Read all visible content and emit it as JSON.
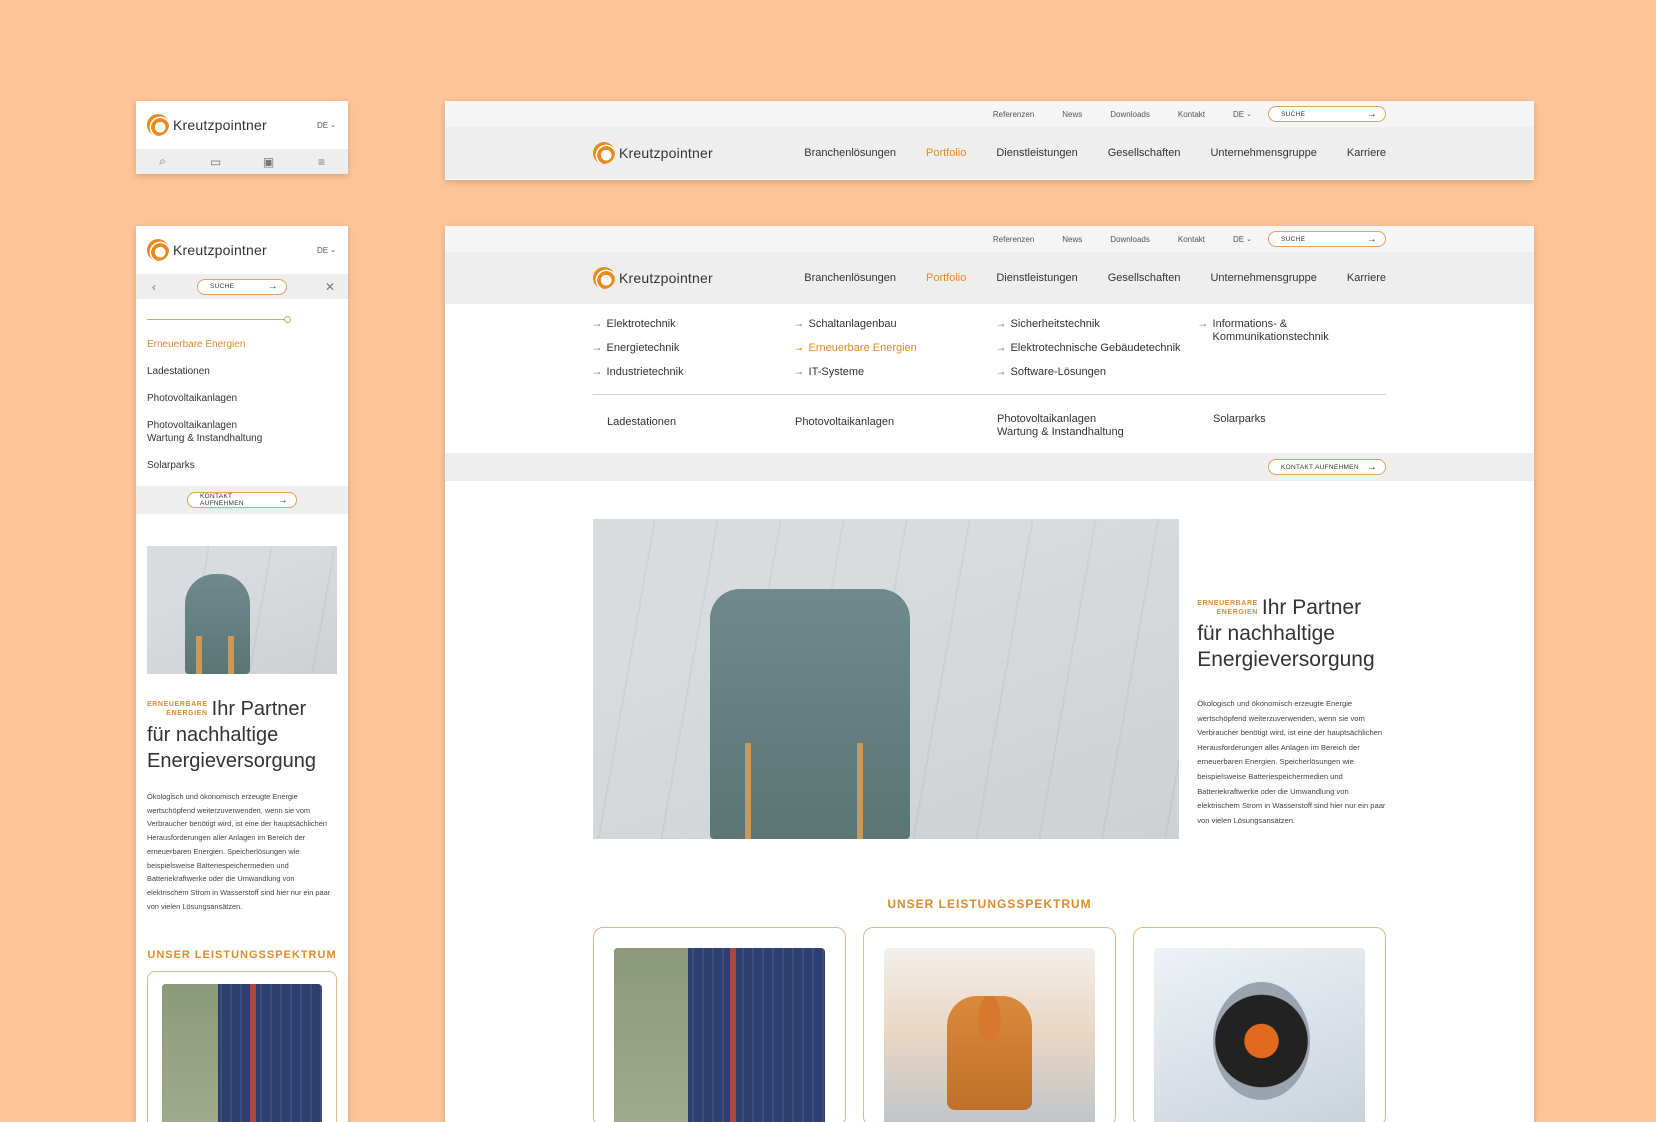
{
  "brand": {
    "name": "Kreutzpointner",
    "lang": "DE"
  },
  "topbar": {
    "links": [
      "Referenzen",
      "News",
      "Downloads",
      "Kontakt"
    ],
    "lang": "DE",
    "search_label": "SUCHE"
  },
  "nav": {
    "items": [
      "Branchenlösungen",
      "Portfolio",
      "Dienstleistungen",
      "Gesellschaften",
      "Unternehmensgruppe",
      "Karriere"
    ],
    "active": "Portfolio"
  },
  "mega": {
    "col1": [
      "Elektrotechnik",
      "Energietechnik",
      "Industrietechnik"
    ],
    "col2": [
      "Schaltanlagenbau",
      "Erneuerbare Energien",
      "IT-Systeme"
    ],
    "col3": [
      "Sicherheitstechnik",
      "Elektrotechnische Gebäudetechnik",
      "Software-Lösungen"
    ],
    "col4": [
      "Informations- & Kommunikationstechnik"
    ],
    "selected": "Erneuerbare Energien",
    "sub": [
      "Ladestationen",
      "Photovoltaikanlagen",
      "Photovoltaikanlagen Wartung & Instandhaltung",
      "Solarparks"
    ]
  },
  "cta": {
    "label": "KONTAKT AUFNEHMEN"
  },
  "mobile": {
    "section_title": "Erneuerbare Energien",
    "sub": [
      "Ladestationen",
      "Photovoltaikanlagen",
      "Photovoltaikanlagen Wartung & Instandhaltung",
      "Solarparks"
    ]
  },
  "hero": {
    "tag_line1": "ERNEUERBARE",
    "tag_line2": "ENERGIEN",
    "title_part1": "Ihr Partner",
    "title_part2": "für nachhaltige",
    "title_part3": "Energieversorgung",
    "paragraph": "Ökologisch und ökonomisch erzeugte Energie wertschöpfend weiterzuverwenden, wenn sie vom Verbraucher benötigt wird, ist eine der hauptsächlichen Herausforderungen aller Anlagen im Bereich der erneuerbaren Energien. Speicherlösungen wie beispielsweise Batteriespeichermedien und Batteriekraftwerke oder die Umwandlung von elektrischem Strom in Wasserstoff sind hier nur ein paar von vielen Lösungsansätzen."
  },
  "services": {
    "title": "UNSER LEISTUNGSSPEKTRUM"
  },
  "colors": {
    "background": "#fdc597",
    "accent": "#e08a2a",
    "header": "#eeeeee"
  }
}
